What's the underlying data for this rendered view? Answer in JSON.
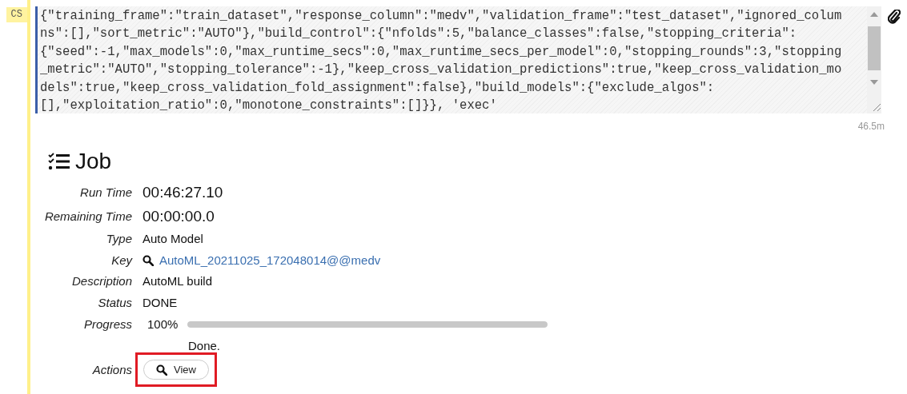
{
  "cell": {
    "prompt": "CS",
    "code_lines": [
      "{\"training_frame\":\"train_dataset\",\"response_column\":\"medv\",\"validation_frame\":\"test_dataset\",\"ignored_colum",
      "ns\":[],\"sort_metric\":\"AUTO\"},\"build_control\":{\"nfolds\":5,\"balance_classes\":false,\"stopping_criteria\":",
      "{\"seed\":-1,\"max_models\":0,\"max_runtime_secs\":0,\"max_runtime_secs_per_model\":0,\"stopping_rounds\":3,\"stopping",
      "_metric\":\"AUTO\",\"stopping_tolerance\":-1},\"keep_cross_validation_predictions\":true,\"keep_cross_validation_mo",
      "dels\":true,\"keep_cross_validation_fold_assignment\":false},\"build_models\":{\"exclude_algos\":",
      "[],\"exploitation_ratio\":0,\"monotone_constraints\":[]}}, 'exec'"
    ],
    "elapsed": "46.5m"
  },
  "job": {
    "title": "Job",
    "fields": [
      {
        "kind": "time",
        "label": "Run Time",
        "value": "00:46:27.10"
      },
      {
        "kind": "time",
        "label": "Remaining Time",
        "value": "00:00:00.0"
      },
      {
        "kind": "text",
        "label": "Type",
        "value": "Auto Model"
      },
      {
        "kind": "link",
        "label": "Key",
        "value": "AutoML_20211025_172048014@@medv"
      },
      {
        "kind": "text",
        "label": "Description",
        "value": "AutoML build"
      },
      {
        "kind": "text",
        "label": "Status",
        "value": "DONE"
      },
      {
        "kind": "progress",
        "label": "Progress",
        "value": "100%",
        "level": 1,
        "message": "Done."
      },
      {
        "kind": "actions",
        "label": "Actions",
        "buttons": [
          {
            "label": "View",
            "highlighted": true
          }
        ]
      }
    ]
  }
}
